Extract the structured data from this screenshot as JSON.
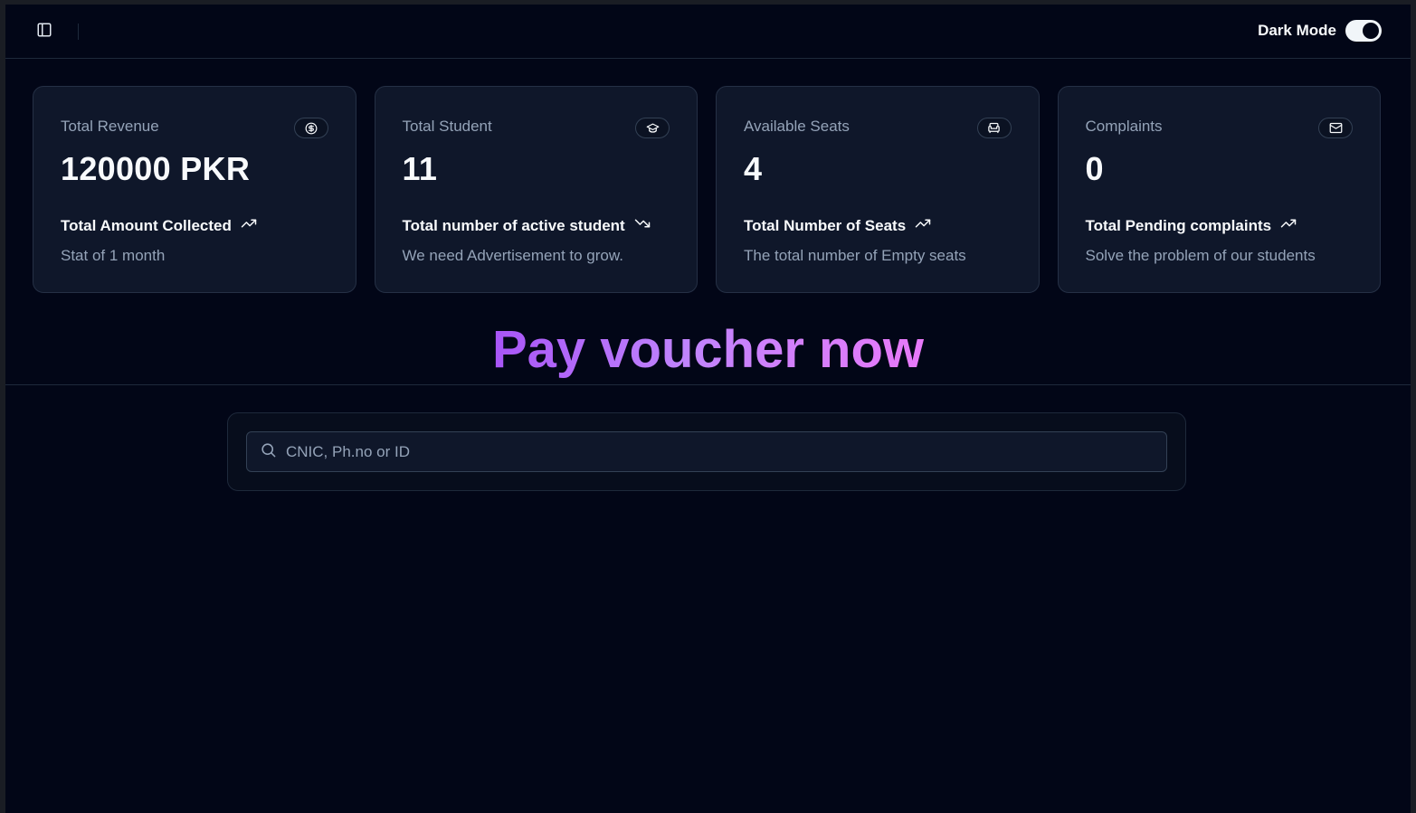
{
  "topbar": {
    "sidebar_toggle_icon": "panel-left-icon",
    "dark_mode_label": "Dark Mode",
    "dark_mode_on": true
  },
  "cards": [
    {
      "title": "Total Revenue",
      "icon": "dollar-sign-icon",
      "value": "120000 PKR",
      "subtitle": "Total Amount Collected",
      "trend_icon": "trending-up-icon",
      "description": "Stat of 1 month"
    },
    {
      "title": "Total Student",
      "icon": "graduation-cap-icon",
      "value": "11",
      "subtitle": "Total number of active student",
      "trend_icon": "trending-down-icon",
      "description": "We need Advertisement to grow."
    },
    {
      "title": "Available Seats",
      "icon": "armchair-icon",
      "value": "4",
      "subtitle": "Total Number of Seats",
      "trend_icon": "trending-up-icon",
      "description": "The total number of Empty seats"
    },
    {
      "title": "Complaints",
      "icon": "mail-icon",
      "value": "0",
      "subtitle": "Total Pending complaints",
      "trend_icon": "trending-up-icon",
      "description": "Solve the problem of our students"
    }
  ],
  "main": {
    "heading": "Pay voucher now",
    "search": {
      "icon": "search-icon",
      "placeholder": "CNIC, Ph.no or ID",
      "value": ""
    }
  },
  "colors": {
    "background": "#020617",
    "card": "#0f172a",
    "muted_text": "#94a3b8",
    "heading_gradient_start": "#a855f7",
    "heading_gradient_end": "#e879f9"
  }
}
